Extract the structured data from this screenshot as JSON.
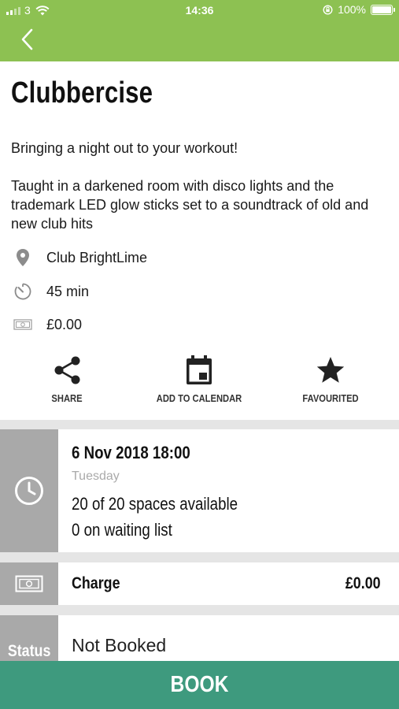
{
  "status_bar": {
    "carrier": "3",
    "time": "14:36",
    "battery": "100%",
    "battery_level": 1.0
  },
  "header": {
    "background_color": "#8dc152",
    "back_icon": "chevron-left-icon"
  },
  "class": {
    "title": "Clubbercise",
    "tagline": "Bringing a night out to your workout!",
    "description": "Taught in a darkened room with disco lights and the trademark LED glow sticks set to a soundtrack of old and new club hits",
    "location": "Club BrightLime",
    "duration": "45 min",
    "price": "£0.00"
  },
  "actions": {
    "share": "SHARE",
    "add_to_calendar": "ADD TO CALENDAR",
    "favourited": "FAVOURITED"
  },
  "slot": {
    "datetime": "6 Nov 2018  18:00",
    "day": "Tuesday",
    "spaces": "20 of 20 spaces available",
    "waiting": "0 on waiting list"
  },
  "charge": {
    "label": "Charge",
    "value": "£0.00"
  },
  "status": {
    "label": "Status",
    "value": "Not Booked"
  },
  "book_button": {
    "label": "BOOK",
    "color": "#3e9a7e"
  }
}
